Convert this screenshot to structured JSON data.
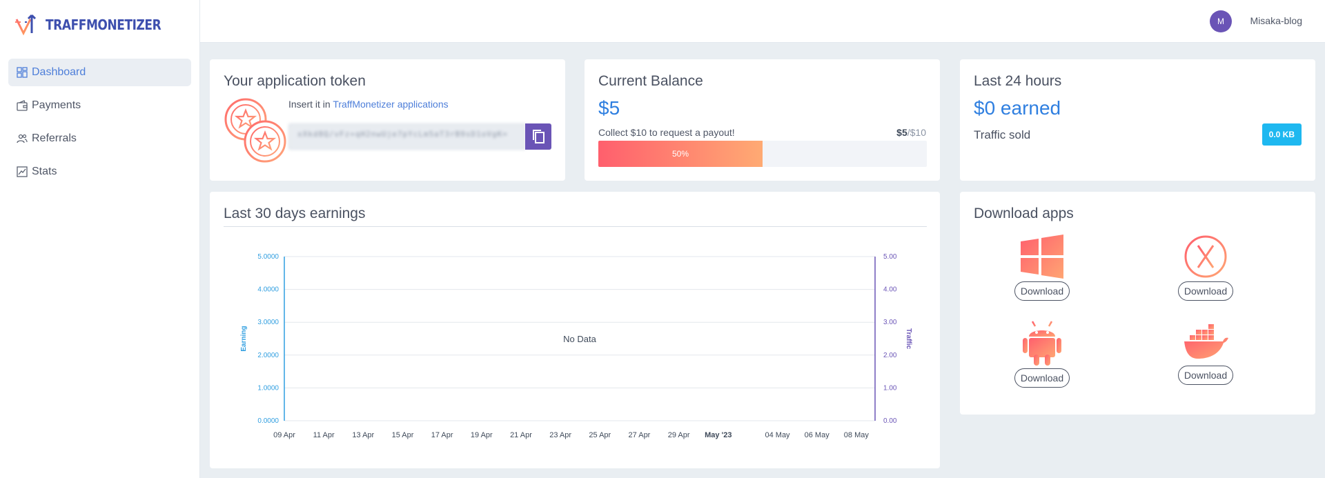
{
  "app": {
    "logo_text": "TRAFFMONETIZER"
  },
  "sidebar": {
    "items": [
      {
        "label": "Dashboard",
        "icon": "dashboard-icon"
      },
      {
        "label": "Payments",
        "icon": "wallet-icon"
      },
      {
        "label": "Referrals",
        "icon": "users-icon"
      },
      {
        "label": "Stats",
        "icon": "chart-icon"
      }
    ]
  },
  "user": {
    "avatar_letter": "M",
    "name": "Misaka-blog"
  },
  "token": {
    "title": "Your application token",
    "insert_prefix": "Insert it in ",
    "insert_link": "TraffMonetizer applications",
    "value": "xXkd8Q/vFz+qH2nwUje7pYcLm5aT3rB9sD1oVgK=",
    "copy_icon": "copy-icon"
  },
  "balance": {
    "title": "Current Balance",
    "value": "$5",
    "payout_text": "Collect $10 to request a payout!",
    "ratio_current": "$5",
    "ratio_target": "/$10",
    "progress_label": "50%",
    "progress_fraction": 0.5,
    "progress_colors": [
      "#ff5f6d",
      "#ffaa73"
    ]
  },
  "last24": {
    "title": "Last 24 hours",
    "earned": "$0 earned",
    "traffic_label": "Traffic sold",
    "traffic_value": "0.0 KB",
    "badge_color": "#1eb8f0"
  },
  "chart": {
    "title": "Last 30 days earnings",
    "no_data": "No Data"
  },
  "chart_data": {
    "type": "line",
    "title": "Last 30 days earnings",
    "xlabel": "",
    "ylabel": "Earning",
    "y2label": "Traffic",
    "x_ticks": [
      "09 Apr",
      "11 Apr",
      "13 Apr",
      "15 Apr",
      "17 Apr",
      "19 Apr",
      "21 Apr",
      "23 Apr",
      "25 Apr",
      "27 Apr",
      "29 Apr",
      "May '23",
      "04 May",
      "06 May",
      "08 May"
    ],
    "y_ticks": [
      "0.0000",
      "1.0000",
      "2.0000",
      "3.0000",
      "4.0000",
      "5.0000"
    ],
    "y2_ticks": [
      "0.00",
      "1.00",
      "2.00",
      "3.00",
      "4.00",
      "5.00"
    ],
    "ylim": [
      0,
      5
    ],
    "y2lim": [
      0,
      5
    ],
    "series": [],
    "grid": true,
    "annotation": "No Data",
    "colors": {
      "left_axis": "#2f9ee0",
      "right_axis": "#6a54b6"
    }
  },
  "downloads": {
    "title": "Download apps",
    "apps": [
      {
        "icon": "windows-icon",
        "label": "Download"
      },
      {
        "icon": "macos-x-icon",
        "label": "Download"
      },
      {
        "icon": "android-icon",
        "label": "Download"
      },
      {
        "icon": "docker-icon",
        "label": "Download"
      }
    ]
  }
}
